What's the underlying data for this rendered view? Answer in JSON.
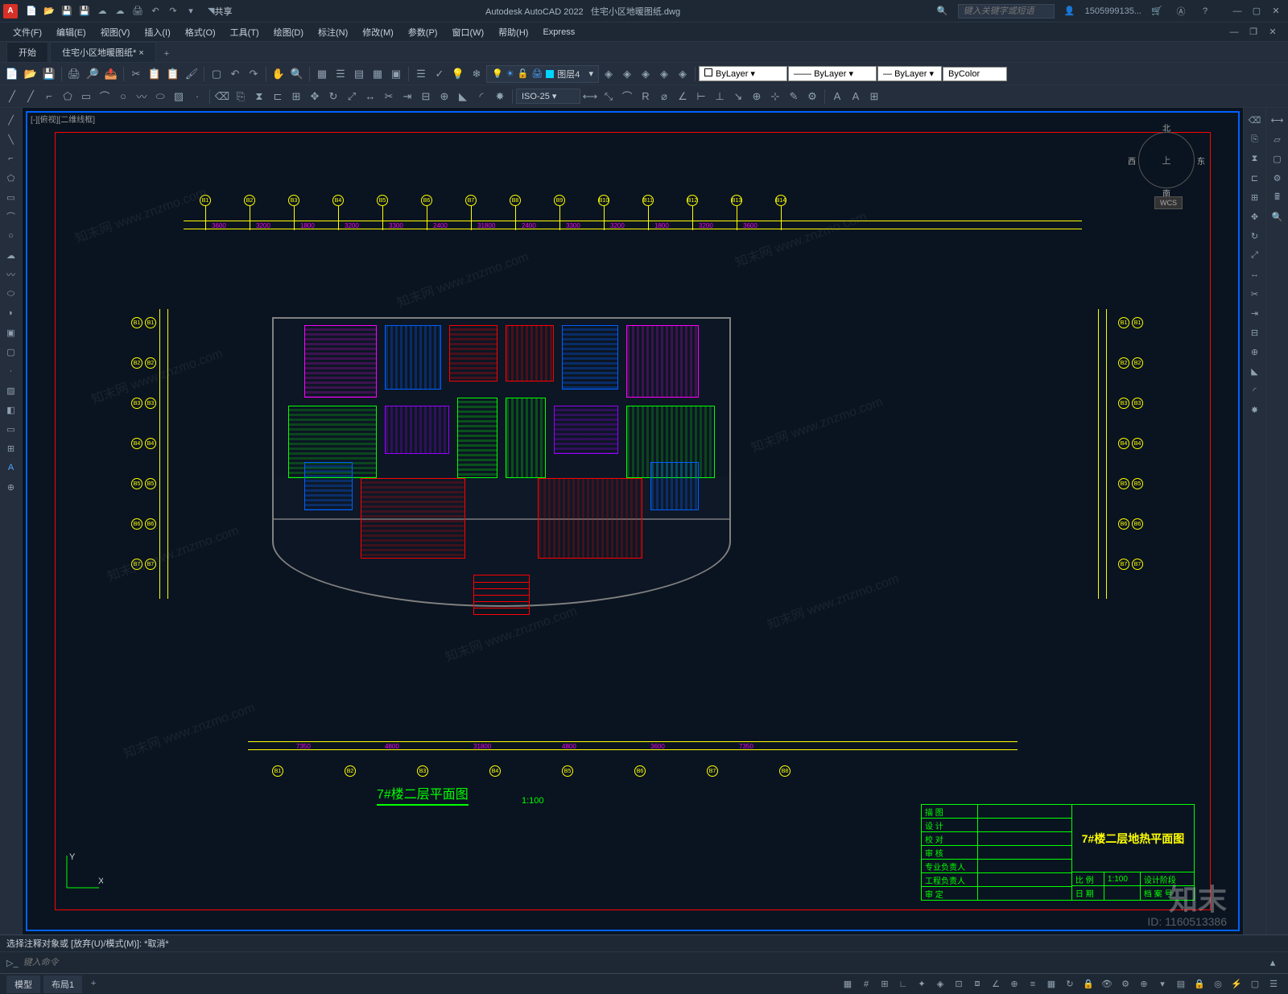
{
  "app": {
    "title_prefix": "Autodesk AutoCAD 2022",
    "document": "住宅小区地暖图纸.dwg",
    "share": "共享"
  },
  "search": {
    "placeholder": "键入关键字或短语"
  },
  "user": {
    "name": "1505999135..."
  },
  "menubar": [
    "文件(F)",
    "编辑(E)",
    "视图(V)",
    "插入(I)",
    "格式(O)",
    "工具(T)",
    "绘图(D)",
    "标注(N)",
    "修改(M)",
    "参数(P)",
    "窗口(W)",
    "帮助(H)",
    "Express"
  ],
  "tabs": {
    "start": "开始",
    "active": "住宅小区地暖图纸*"
  },
  "layer": {
    "current": "图层4"
  },
  "props": {
    "color": "ByLayer",
    "ltype": "ByLayer",
    "lweight": "ByLayer",
    "pstyle": "ByColor"
  },
  "dimstyle": "ISO-25",
  "drawing": {
    "viewport_label": "[-][俯视][二维线框]",
    "title": "7#楼二层平面图",
    "scale": "1:100",
    "compass": {
      "n": "北",
      "s": "南",
      "e": "东",
      "w": "西",
      "u": "上"
    },
    "wcs": "WCS",
    "ucs": {
      "x": "X",
      "y": "Y"
    }
  },
  "titleblock": {
    "rows": [
      "描  图",
      "设  计",
      "校  对",
      "审  核",
      "专业负责人",
      "工程负责人"
    ],
    "main_title": "7#楼二层地热平面图",
    "scale_label": "比  例",
    "scale_val": "1:100",
    "stage_label": "设计阶段",
    "approve": "审  定",
    "date": "日  期",
    "archive": "档  案  号"
  },
  "dims_top": [
    "3600",
    "3200",
    "1800",
    "3200",
    "3300",
    "2400",
    "31800",
    "2400",
    "3300",
    "3200",
    "1800",
    "3200",
    "3600"
  ],
  "dims_bottom": [
    "7350",
    "4800",
    "31800",
    "4800",
    "3600",
    "7350"
  ],
  "grid_bubbles_top": [
    "B1",
    "B2",
    "B3",
    "B4",
    "B5",
    "B6",
    "B7",
    "B8",
    "B9",
    "B10",
    "B11",
    "B12",
    "B13",
    "B14"
  ],
  "cmdline": {
    "history": "选择注释对象或  [放弃(U)/模式(M)]:  *取消*",
    "placeholder": "键入命令"
  },
  "status": {
    "tabs": [
      "模型",
      "布局1"
    ]
  },
  "watermark": {
    "text": "知末网 www.znzmo.com",
    "brand": "知末",
    "id": "ID: 1160513386"
  }
}
